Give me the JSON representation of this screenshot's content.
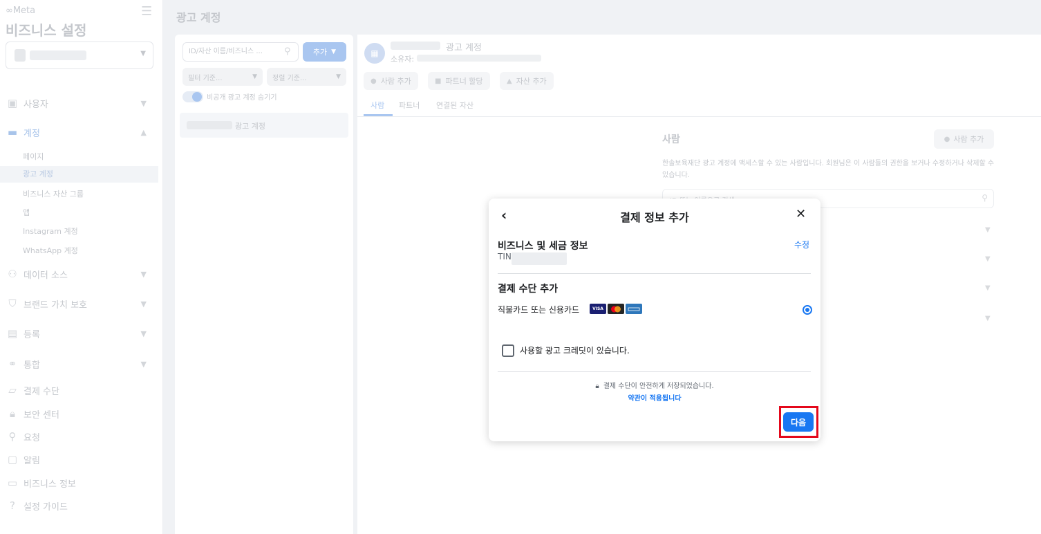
{
  "sidebar": {
    "logo": "∞Meta",
    "title": "비즈니스 설정",
    "items": [
      {
        "label": "사용자"
      },
      {
        "label": "계정"
      },
      {
        "label": "데이터 소스"
      },
      {
        "label": "브랜드 가치 보호"
      },
      {
        "label": "등록"
      },
      {
        "label": "통합"
      },
      {
        "label": "결제 수단"
      },
      {
        "label": "보안 센터"
      },
      {
        "label": "요청"
      },
      {
        "label": "알림"
      },
      {
        "label": "비즈니스 정보"
      },
      {
        "label": "설정 가이드"
      }
    ],
    "account_subitems": [
      {
        "label": "페이지"
      },
      {
        "label": "광고 계정"
      },
      {
        "label": "비즈니스 자산 그룹"
      },
      {
        "label": "앱"
      },
      {
        "label": "Instagram 계정"
      },
      {
        "label": "WhatsApp 계정"
      }
    ]
  },
  "page": {
    "title": "광고 계정"
  },
  "list_panel": {
    "search_placeholder": "ID/자산 이름/비즈니스 ...",
    "add_label": "추가",
    "filter_label": "필터 기준...",
    "sort_label": "정렬 기준...",
    "toggle_label": "비공개 광고 계정 숨기기",
    "row_label": "광고 계정"
  },
  "detail": {
    "account_title": "광고 계정",
    "owner_label": "소유자:",
    "actions": [
      {
        "label": "사람 추가"
      },
      {
        "label": "파트너 할당"
      },
      {
        "label": "자산 추가"
      }
    ],
    "tabs": [
      {
        "label": "사람"
      },
      {
        "label": "파트너"
      },
      {
        "label": "연결된 자산"
      }
    ],
    "people_title": "사람",
    "people_add_label": "사람 추가",
    "people_desc": "한솔보육재단 광고 계정에 액세스할 수 있는 사람입니다. 회원님은 이 사람들의 권한을 보거나 수정하거나 삭제할 수 있습니다.",
    "people_search_placeholder": "ID 또는 이름으로 검색"
  },
  "modal": {
    "title": "결제 정보 추가",
    "business_tax_title": "비즈니스 및 세금 정보",
    "edit_label": "수정",
    "tin_label": "TIN",
    "payment_method_title": "결제 수단 추가",
    "card_option_label": "직불카드 또는 신용카드",
    "card_brands": [
      "VISA",
      "MC",
      "AMEX"
    ],
    "credit_label": "사용할 광고 크레딧이 있습니다.",
    "secure_text": "결제 수단이 안전하게 저장되었습니다.",
    "terms_link": "약관이 적용됩니다",
    "next_label": "다음"
  },
  "colors": {
    "accent": "#1877f2",
    "highlight_border": "#e4081b"
  }
}
